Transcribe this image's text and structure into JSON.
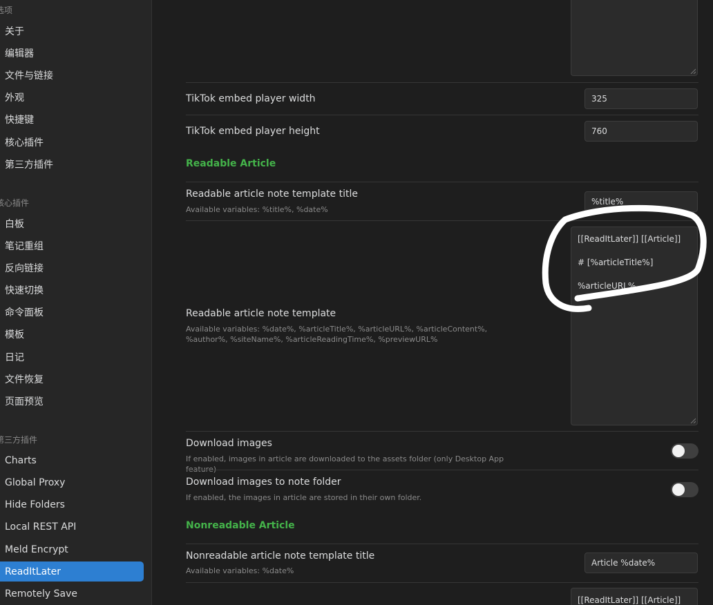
{
  "sidebar": {
    "group_options": "选项",
    "group_core": "核心插件",
    "group_community": "第三方插件",
    "options": [
      "关于",
      "编辑器",
      "文件与链接",
      "外观",
      "快捷键",
      "核心插件",
      "第三方插件"
    ],
    "core": [
      "白板",
      "笔记重组",
      "反向链接",
      "快速切换",
      "命令面板",
      "模板",
      "日记",
      "文件恢复",
      "页面预览"
    ],
    "community": [
      "Charts",
      "Global Proxy",
      "Hide Folders",
      "Local REST API",
      "Meld Encrypt",
      "ReadItLater",
      "Remotely Save"
    ],
    "active": "ReadItLater",
    "accent": "#2d7fd2"
  },
  "settings": {
    "tiktok_width": {
      "name": "TikTok embed player width",
      "value": "325"
    },
    "tiktok_height": {
      "name": "TikTok embed player height",
      "value": "760"
    },
    "readable_heading": "Readable Article",
    "readable_title": {
      "name": "Readable article note template title",
      "desc": "Available variables: %title%, %date%",
      "value": "%title%"
    },
    "readable_template": {
      "name": "Readable article note template",
      "desc": "Available variables: %date%, %articleTitle%, %articleURL%, %articleContent%, %author%, %siteName%, %articleReadingTime%, %previewURL%",
      "lines": [
        "[[ReadItLater]] [[Article]]",
        "# [%articleTitle%]",
        "%articleURL%"
      ]
    },
    "download_images": {
      "name": "Download images",
      "desc": "If enabled, images in article are downloaded to the assets folder (only Desktop App feature)",
      "enabled": false
    },
    "download_images_folder": {
      "name": "Download images to note folder",
      "desc": "If enabled, the images in article are stored in their own folder.",
      "enabled": false
    },
    "nonreadable_heading": "Nonreadable Article",
    "nonreadable_title": {
      "name": "Nonreadable article note template title",
      "desc": "Available variables: %date%",
      "value": "Article %date%"
    },
    "nonreadable_template_first_line": "[[ReadItLater]] [[Article]]"
  },
  "colors": {
    "section_heading": "#44b34a",
    "annotation": "#ffffff"
  }
}
